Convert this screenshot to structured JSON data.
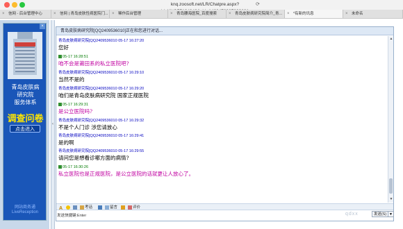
{
  "browser": {
    "url": "knq.zoosoft.net/LR/Chatpre.aspx?id=KNQ75134940&cid=1463472927033621",
    "tabs": [
      {
        "label": "信网 - 后台管理中心",
        "active": false
      },
      {
        "label": "信网 | 青岛皮肤性病医院门...",
        "active": false
      },
      {
        "label": "稀作后台管理",
        "active": false
      },
      {
        "label": "青岛腰海医院_百度搜索",
        "active": false
      },
      {
        "label": "青岛皮肤病研究院简介_青...",
        "active": false
      },
      {
        "label": "*有新的讯息",
        "active": true
      },
      {
        "label": "未命名",
        "active": false
      }
    ]
  },
  "ad": {
    "title_lines": [
      "青岛皮肤病",
      "研究院",
      "服务体系"
    ],
    "survey": "调查问卷",
    "enter_button": "点击进入",
    "logo_text": [
      "网站商务通",
      "LiveReception"
    ]
  },
  "chat": {
    "header": "青岛皮肤病研究院[QQ2409536010]正在和您进行对话...",
    "messages": [
      {
        "role": "visitor",
        "meta": "青岛皮肤病研究院[QQ2409536010 05-17 16:27:20",
        "text": "您好"
      },
      {
        "role": "staff",
        "meta": "05-17 16:28:51",
        "text": "咱不会是莆田系的私立医院吧?"
      },
      {
        "role": "visitor",
        "meta": "青岛皮肤病研究院[QQ2409536010 05-17 16:29:10",
        "text": "当然不是的"
      },
      {
        "role": "visitor",
        "meta": "青岛皮肤病研究院[QQ2409536010 05-17 16:29:20",
        "text": "咱们是青岛皮肤病研究院    国家正规医院"
      },
      {
        "role": "staff",
        "meta": "05-17 16:29:31",
        "text": "是公立医院吗?"
      },
      {
        "role": "visitor",
        "meta": "青岛皮肤病研究院[QQ2409536010 05-17 16:29:32",
        "text": "不是个人门诊  涉您请放心"
      },
      {
        "role": "visitor",
        "meta": "青岛皮肤病研究院[QQ2409536010 05-17 16:29:41",
        "text": "是的啊"
      },
      {
        "role": "visitor",
        "meta": "青岛皮肤病研究院[QQ2409536010 05-17 16:29:55",
        "text": "请问您是想看诊哪方面的病情?"
      },
      {
        "role": "staff",
        "meta": "05-17 16:30:26",
        "text": "私立医院也是正规医院，是公立医院的话就更让人放心了。"
      }
    ]
  },
  "toolbar": {
    "items": [
      {
        "label": "",
        "icon": "font-icon"
      },
      {
        "label": "",
        "icon": "emoji-icon"
      },
      {
        "label": "",
        "icon": "screenshot-icon"
      },
      {
        "label": "",
        "icon": "file-icon"
      },
      {
        "label": "考话",
        "icon": "phrase-icon"
      },
      {
        "label": "",
        "icon": "save-icon"
      },
      {
        "label": "留言",
        "icon": "message-icon"
      },
      {
        "label": "",
        "icon": "rate-icon"
      },
      {
        "label": "评价",
        "icon": "evaluate-icon"
      }
    ]
  },
  "send": {
    "hint": "发送快捷键:Enter",
    "button": "发送(S)",
    "dropdown": "▼"
  },
  "watermark": "qdxx",
  "colors": {
    "visitor_meta": "#0000c0",
    "staff_meta": "#007a00",
    "staff_text": "#c000a0",
    "ad_blue": "#1a56b8",
    "ad_survey": "#ffe600"
  }
}
